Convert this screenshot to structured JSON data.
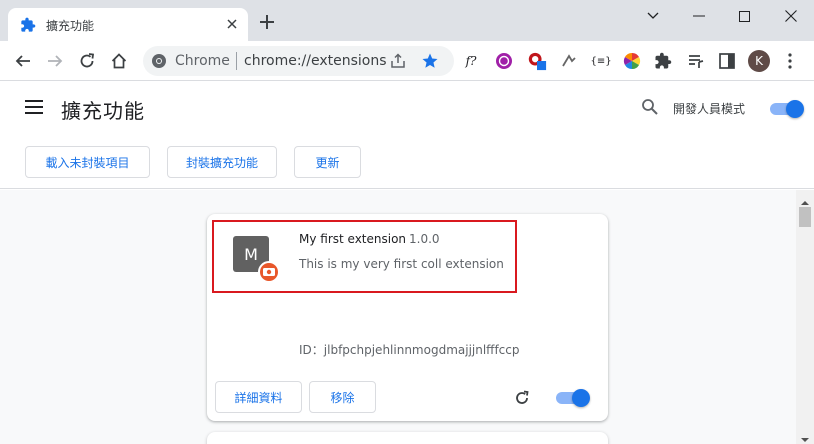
{
  "tab": {
    "title": "擴充功能"
  },
  "omnibox": {
    "brand": "Chrome",
    "url": "chrome://extensions"
  },
  "profile": {
    "initial": "K"
  },
  "toolbar_icons": [
    "font-ext-icon",
    "lr-ext-icon",
    "adblock-ext-icon",
    "jump-ext-icon",
    "json-ext-icon",
    "color-ext-icon",
    "puzzle-icon",
    "media-icon",
    "sidepanel-icon"
  ],
  "toolbar_texts": {
    "font": "f?",
    "json": "{≡}"
  },
  "header": {
    "title": "擴充功能",
    "devmode_label": "開發人員模式"
  },
  "actions": {
    "load_unpacked": "載入未封裝項目",
    "pack": "封裝擴充功能",
    "update": "更新"
  },
  "extension": {
    "logo_letter": "M",
    "name": "My first extension",
    "version": "1.0.0",
    "description": "This is my very first coll extension",
    "id_text": "ID：jlbfpchpjehlinnmogdmajjjnlfffccp",
    "details_label": "詳細資料",
    "remove_label": "移除",
    "enabled": true
  },
  "devmode_enabled": true,
  "colors": {
    "accent": "#1a73e8",
    "highlight": "#d9191f",
    "badge": "#e8572a"
  }
}
